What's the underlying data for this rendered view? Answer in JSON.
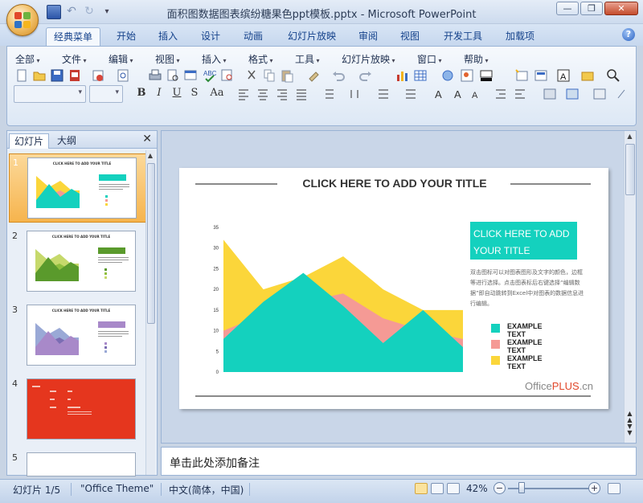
{
  "window": {
    "title": "面积图数据图表缤纷糖果色ppt模板.pptx - Microsoft PowerPoint",
    "controls": [
      "—",
      "❐",
      "✕"
    ]
  },
  "ribbon_tabs": [
    {
      "label": "经典菜单",
      "active": true
    },
    {
      "label": "开始"
    },
    {
      "label": "插入"
    },
    {
      "label": "设计"
    },
    {
      "label": "动画"
    },
    {
      "label": "幻灯片放映"
    },
    {
      "label": "审阅"
    },
    {
      "label": "视图"
    },
    {
      "label": "开发工具"
    },
    {
      "label": "加载项"
    }
  ],
  "classic_menu": [
    "全部",
    "文件",
    "编辑",
    "视图",
    "插入",
    "格式",
    "工具",
    "幻灯片放映",
    "窗口",
    "帮助"
  ],
  "format_buttons": [
    "B",
    "I",
    "U",
    "S",
    "Aa"
  ],
  "left_pane": {
    "tabs": [
      "幻灯片",
      "大纲"
    ],
    "close": "✕",
    "slides": [
      {
        "number": "1",
        "title": "CLICK HERE TO ADD YOUR TITLE",
        "selected": true,
        "theme": "candy"
      },
      {
        "number": "2",
        "title": "CLICK HERE TO ADD YOUR TITLE",
        "theme": "green"
      },
      {
        "number": "3",
        "title": "CLICK HERE TO ADD YOUR TITLE",
        "theme": "purple"
      },
      {
        "number": "4",
        "title": "",
        "theme": "red"
      },
      {
        "number": "5",
        "title": "",
        "theme": "blank"
      }
    ]
  },
  "slide": {
    "title": "CLICK HERE TO ADD YOUR TITLE",
    "box_title": "CLICK HERE TO ADD YOUR TITLE",
    "box_text": "双击图标可以对图表图形及文字的颜色，边框等进行选择。点击图表标后右键选择“编辑数据”即自动跳转到Excel中对图表的数据信息进行编辑。",
    "logo": {
      "main": "Office",
      "accent": "PLUS",
      "suffix": ".cn"
    },
    "colors": {
      "teal": "#14d1be",
      "pink": "#f59a95",
      "yellow": "#fbd63a",
      "rule": "#8a8a8a"
    }
  },
  "chart_data": {
    "type": "area",
    "x": [
      0,
      1,
      2,
      3,
      4,
      5,
      6
    ],
    "yticks": [
      "0",
      "5",
      "10",
      "15",
      "20",
      "25",
      "30",
      "35"
    ],
    "ylim": [
      0,
      35
    ],
    "series": [
      {
        "name": "EXAMPLE TEXT",
        "color": "#fbd63a",
        "values": [
          32,
          20,
          23,
          28,
          20,
          15,
          15
        ]
      },
      {
        "name": "EXAMPLE TEXT",
        "color": "#f59a95",
        "values": [
          10,
          14,
          17,
          19,
          13,
          10,
          8
        ]
      },
      {
        "name": "EXAMPLE TEXT",
        "color": "#14d1be",
        "values": [
          8,
          17,
          24,
          16,
          7,
          15,
          6
        ]
      }
    ],
    "legend": "right"
  },
  "notes": {
    "placeholder": "单击此处添加备注"
  },
  "status": {
    "slide_info": "幻灯片 1/5",
    "theme": "\"Office Theme\"",
    "language": "中文(简体，中国)",
    "zoom": "42%",
    "zoom_minus": "−",
    "zoom_plus": "+"
  }
}
